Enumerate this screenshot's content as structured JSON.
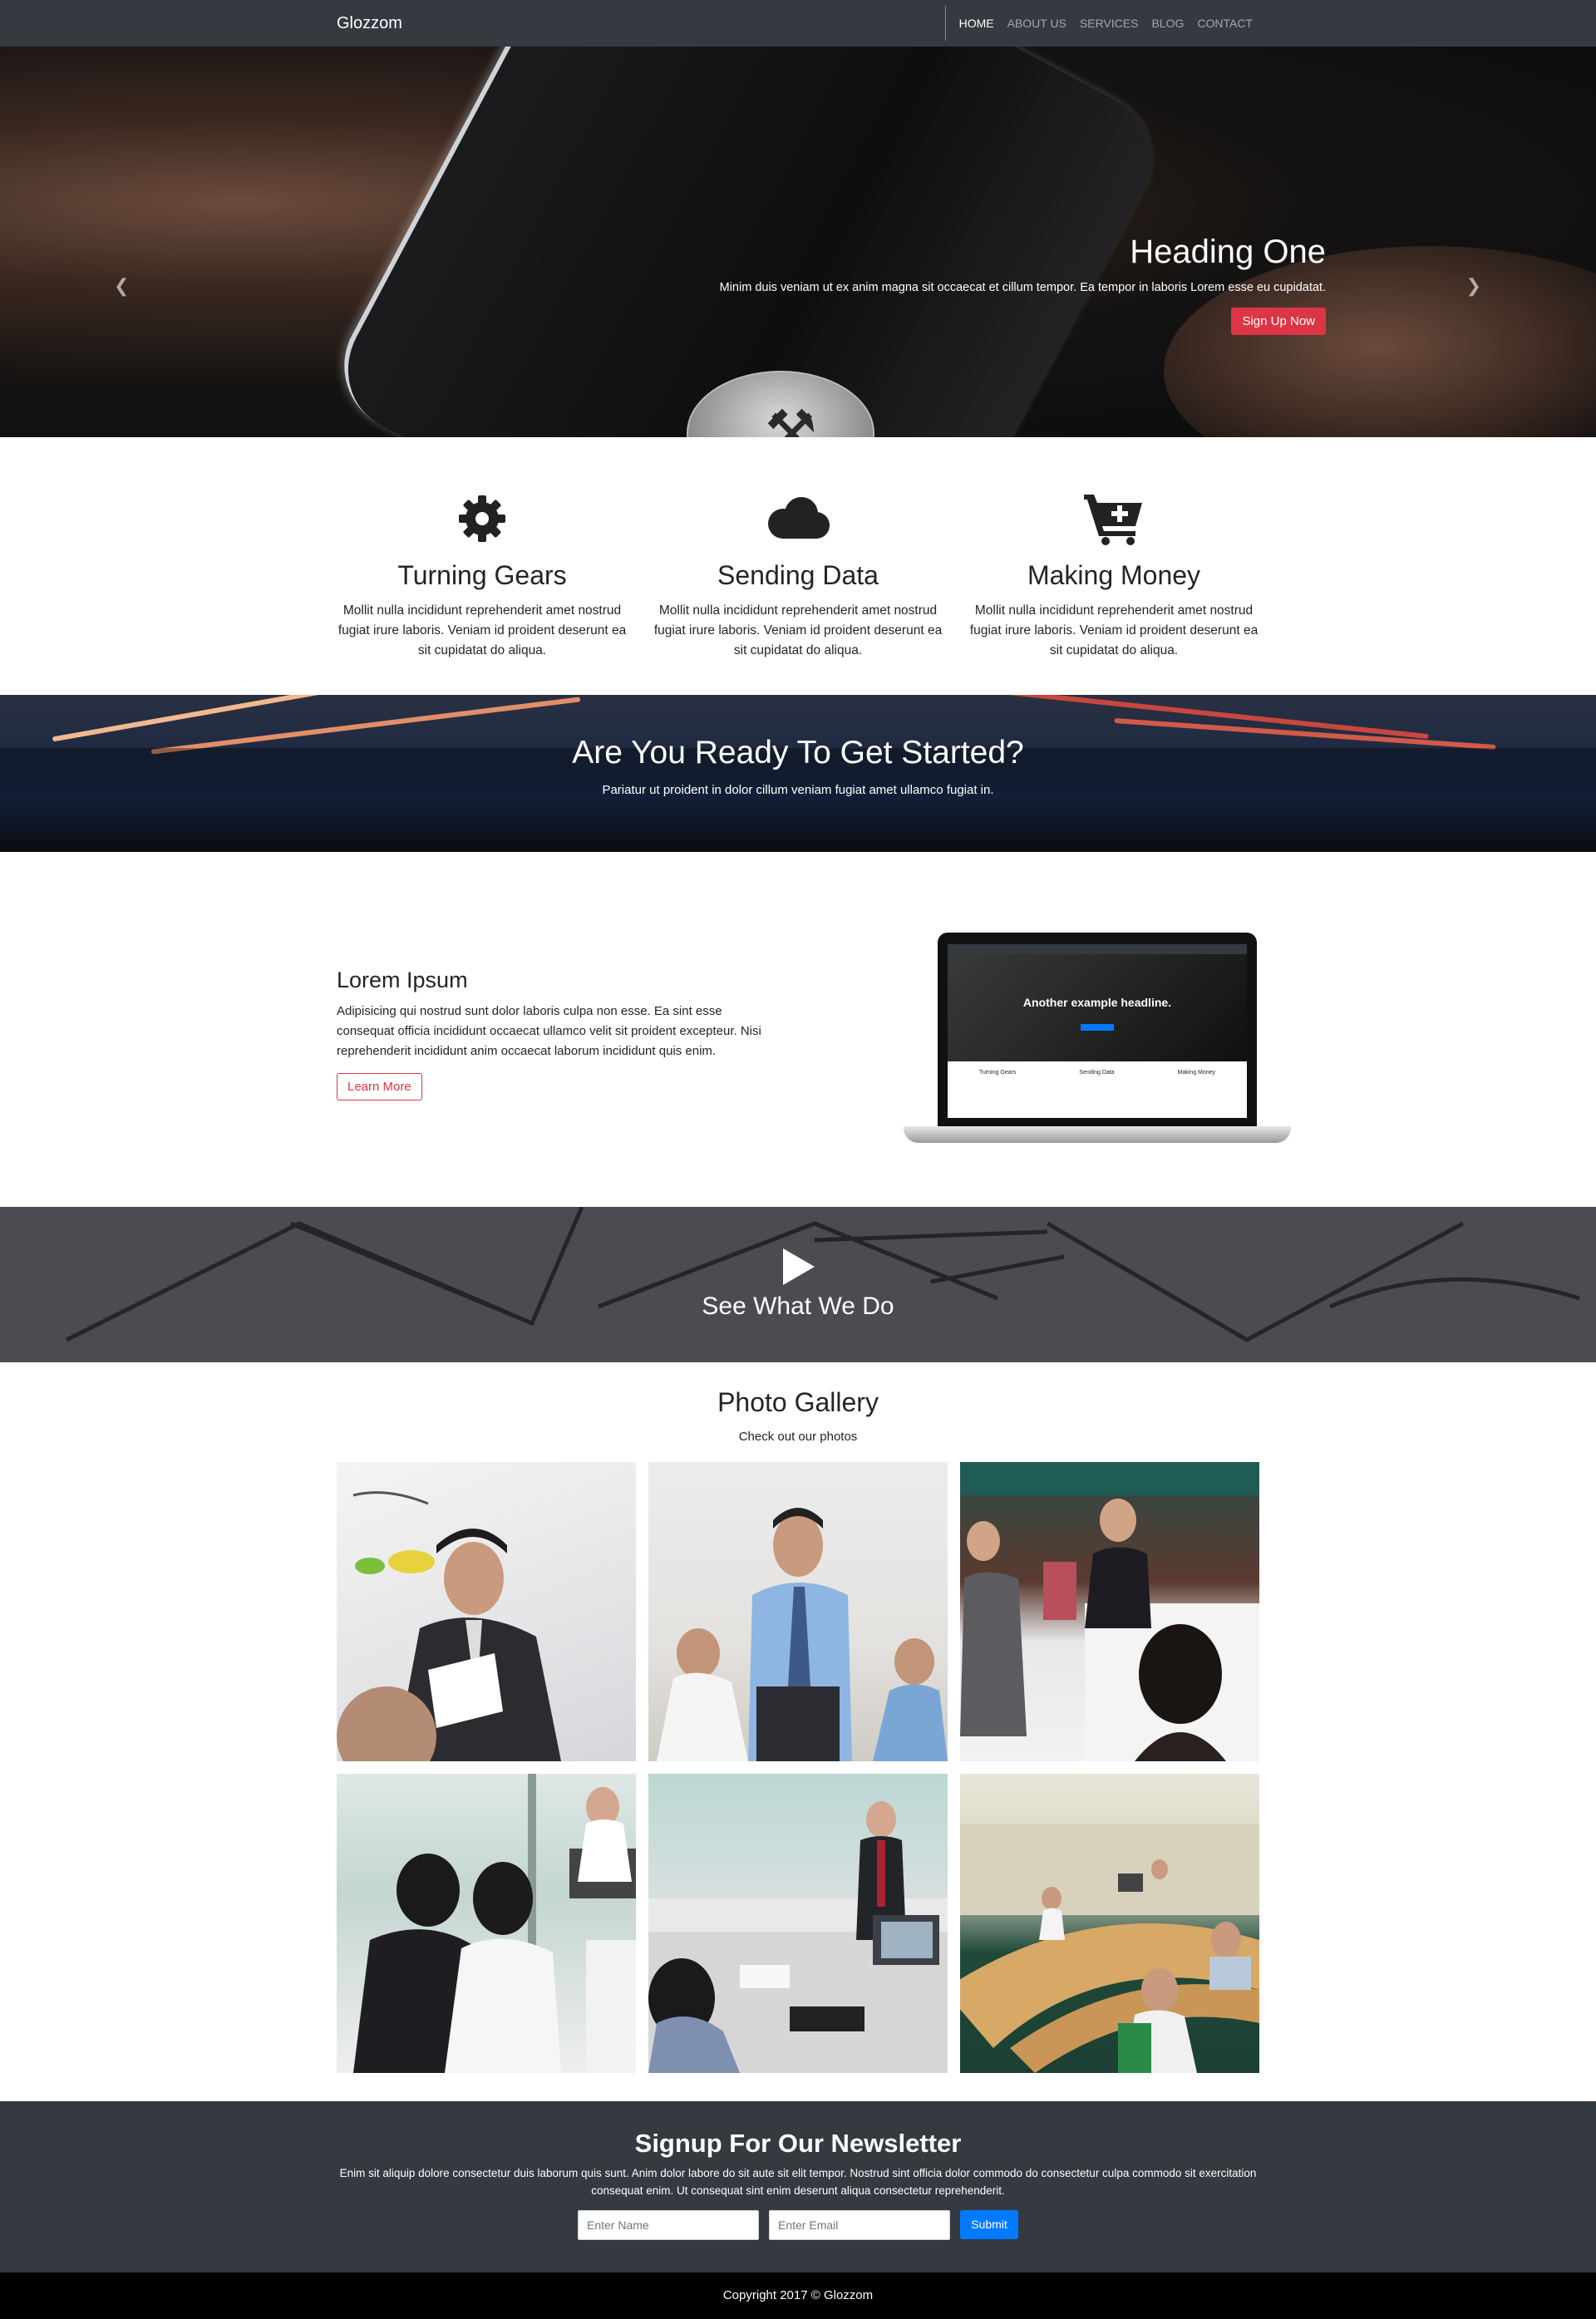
{
  "navbar": {
    "brand": "Glozzom",
    "links": [
      "HOME",
      "ABOUT US",
      "SERVICES",
      "BLOG",
      "CONTACT"
    ],
    "active_index": 0
  },
  "hero": {
    "heading": "Heading One",
    "text": "Minim duis veniam ut ex anim magna sit occaecat et cillum tempor. Ea tempor in laboris Lorem esse eu cupidatat.",
    "button": "Sign Up Now",
    "slide_count": 3,
    "active_slide": 1
  },
  "features": [
    {
      "icon": "gear-icon",
      "title": "Turning Gears",
      "text": "Mollit nulla incididunt reprehenderit amet nostrud fugiat irure laboris. Veniam id proident deserunt ea sit cupidatat do aliqua."
    },
    {
      "icon": "cloud-icon",
      "title": "Sending Data",
      "text": "Mollit nulla incididunt reprehenderit amet nostrud fugiat irure laboris. Veniam id proident deserunt ea sit cupidatat do aliqua."
    },
    {
      "icon": "cart-plus-icon",
      "title": "Making Money",
      "text": "Mollit nulla incididunt reprehenderit amet nostrud fugiat irure laboris. Veniam id proident deserunt ea sit cupidatat do aliqua."
    }
  ],
  "banner": {
    "heading": "Are You Ready To Get Started?",
    "text": "Pariatur ut proident in dolor cillum veniam fugiat amet ullamco fugiat in."
  },
  "lorem": {
    "heading": "Lorem Ipsum",
    "text": "Adipisicing qui nostrud sunt dolor laboris culpa non esse. Ea sint esse consequat officia incididunt occaecat ullamco velit sit proident excepteur. Nisi reprehenderit incididunt anim occaecat laborum incididunt quis enim.",
    "button": "Learn More",
    "laptop_screen": {
      "headline": "Another example headline.",
      "features": [
        "Turning Gears",
        "Sending Data",
        "Making Money"
      ]
    }
  },
  "video": {
    "heading": "See What We Do"
  },
  "gallery": {
    "heading": "Photo Gallery",
    "subheading": "Check out our photos",
    "photos": [
      "photo-1",
      "photo-2",
      "photo-3",
      "photo-4",
      "photo-5",
      "photo-6"
    ]
  },
  "newsletter": {
    "heading": "Signup For Our Newsletter",
    "text": "Enim sit aliquip dolore consectetur duis laborum quis sunt. Anim dolor labore do sit aute sit elit tempor. Nostrud sint officia dolor commodo do consectetur culpa commodo sit exercitation consequat enim. Ut consequat sint enim deserunt aliqua consectetur reprehenderit.",
    "name_placeholder": "Enter Name",
    "email_placeholder": "Enter Email",
    "submit": "Submit"
  },
  "footer": {
    "copyright": "Copyright 2017 © Glozzom"
  },
  "colors": {
    "dark": "#343a40",
    "danger": "#dc3545",
    "primary": "#007bff"
  }
}
